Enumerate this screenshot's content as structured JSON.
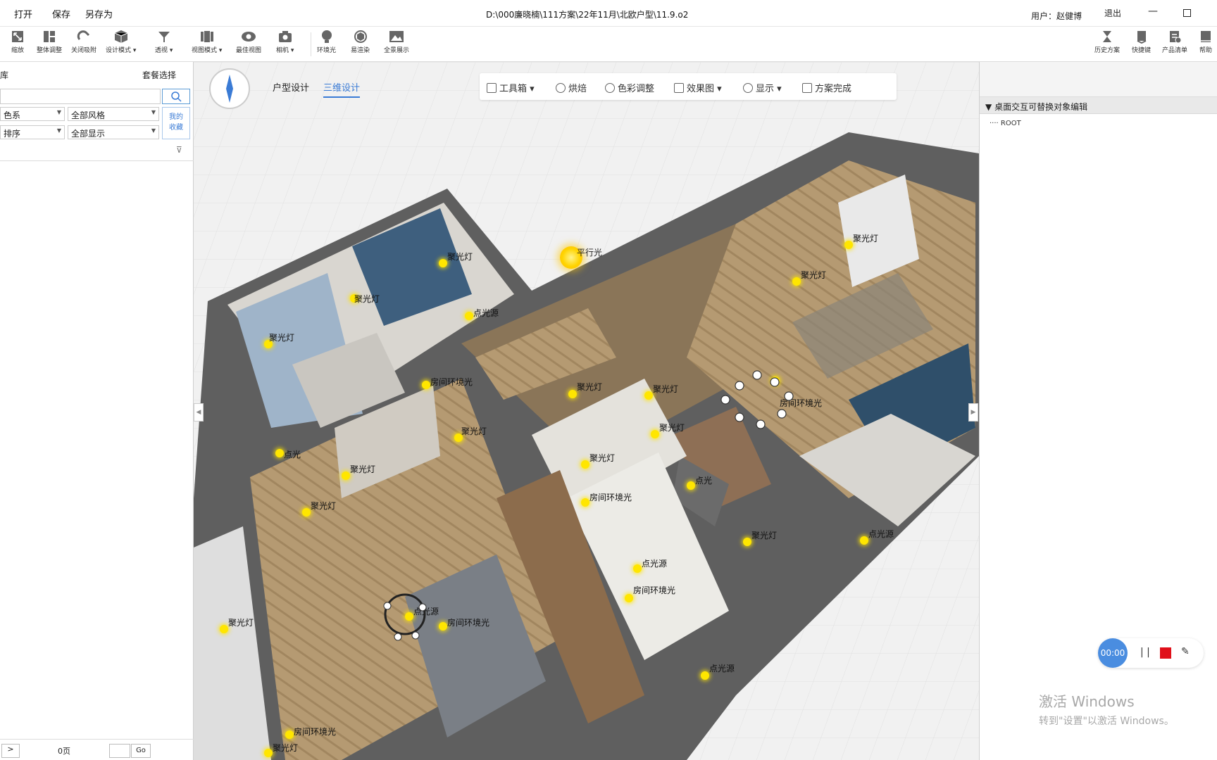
{
  "titlebar": {
    "menu": [
      "打开",
      "保存",
      "另存为"
    ],
    "file_path": "D:\\000廉晓楠\\111方案\\22年11月\\北欧户型\\11.9.o2",
    "user": "用户：赵健博",
    "logout": "退出"
  },
  "toolbar": {
    "tools": [
      {
        "label": "缩放",
        "icon": "zoom-icon"
      },
      {
        "label": "整体调整",
        "icon": "layout-adjust-icon"
      },
      {
        "label": "关闭吸附",
        "icon": "magnet-icon"
      },
      {
        "label": "设计模式",
        "icon": "cube-icon"
      },
      {
        "label": "透视",
        "icon": "perspective-icon"
      },
      {
        "label": "视图模式",
        "icon": "view-mode-icon"
      },
      {
        "label": "最佳视图",
        "icon": "eye-icon"
      },
      {
        "label": "相机",
        "icon": "camera-icon"
      },
      {
        "label": "环境光",
        "icon": "ambient-light-icon"
      },
      {
        "label": "易渲染",
        "icon": "render-icon"
      },
      {
        "label": "全景展示",
        "icon": "panorama-icon"
      }
    ],
    "right_tools": [
      {
        "label": "历史方案",
        "icon": "hourglass-icon"
      },
      {
        "label": "快捷键",
        "icon": "shortcut-icon"
      },
      {
        "label": "产品清单",
        "icon": "product-list-icon"
      },
      {
        "label": "帮助",
        "icon": "help-icon"
      }
    ]
  },
  "left_panel": {
    "title": "库",
    "package_select": "套餐选择",
    "dropdowns": [
      "色系",
      "全部风格",
      "排序",
      "全部显示"
    ],
    "favorites": [
      "我的",
      "收藏"
    ],
    "pager": {
      "next": ">",
      "count": "0页",
      "go": "Go"
    }
  },
  "viewport": {
    "tabs": [
      "户型设计",
      "三维设计"
    ],
    "active_tab": "三维设计",
    "floating_toolbar": [
      "工具箱",
      "烘焙",
      "色彩调整",
      "效果图",
      "显示",
      "方案完成"
    ],
    "sun_label": "平行光",
    "light_labels": [
      "聚光灯",
      "聚光灯",
      "点光源",
      "聚光灯",
      "房间环境光",
      "聚光灯",
      "点光",
      "聚光灯",
      "聚光灯",
      "聚光灯",
      "聚光灯",
      "聚光灯",
      "聚光灯",
      "房间环境光",
      "房间环境光",
      "点光",
      "聚光灯",
      "点光源",
      "点光源",
      "房间环境光",
      "点光源",
      "房间环境光",
      "聚光灯",
      "点光源",
      "房间环境光",
      "聚光灯",
      "聚光灯",
      "聚光灯"
    ]
  },
  "right_panel": {
    "tree_title": "桌面交互可替换对象编辑",
    "tree_root": "ROOT",
    "activation_title": "激活 Windows",
    "activation_sub": "转到\"设置\"以激活 Windows。",
    "recorder_time": "00:00"
  },
  "colors": {
    "accent": "#3a7bd5",
    "record_red": "#e0101a",
    "light_yellow": "#ffe600"
  }
}
